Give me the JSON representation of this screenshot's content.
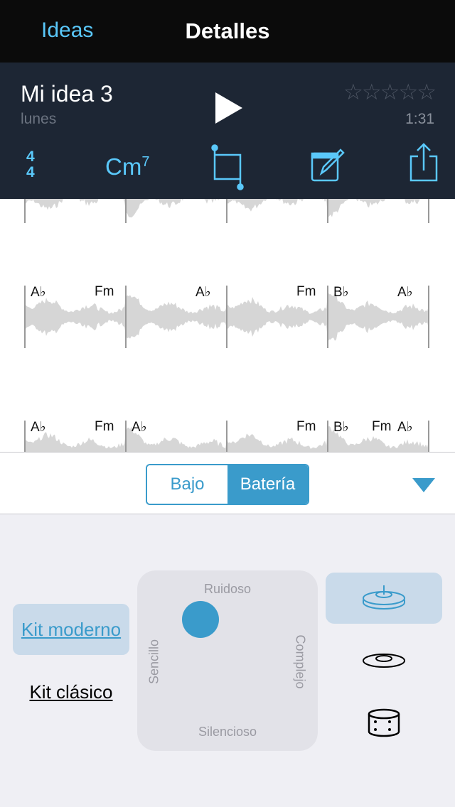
{
  "nav": {
    "back": "Ideas",
    "title": "Detalles"
  },
  "idea": {
    "name": "Mi idea 3",
    "date": "lunes",
    "rating": 0,
    "stars": "☆☆☆☆☆",
    "duration": "1:31"
  },
  "toolbar": {
    "time_sig_top": "4",
    "time_sig_bottom": "4",
    "chord": "Cm",
    "chord_ext": "7",
    "icons": [
      "trim-icon",
      "edit-icon",
      "share-icon"
    ]
  },
  "rows": [
    {
      "chords": []
    },
    {
      "chords": [
        {
          "bar": 0,
          "pos": "start",
          "label": "A♭"
        },
        {
          "bar": 0,
          "pos": "end",
          "label": "Fm"
        },
        {
          "bar": 1,
          "pos": "end",
          "label": "A♭"
        },
        {
          "bar": 2,
          "pos": "end",
          "label": "Fm"
        },
        {
          "bar": 3,
          "pos": "start",
          "label": "B♭"
        },
        {
          "bar": 3,
          "pos": "end",
          "label": "A♭"
        }
      ]
    },
    {
      "chords": [
        {
          "bar": 0,
          "pos": "start",
          "label": "A♭"
        },
        {
          "bar": 0,
          "pos": "end",
          "label": "Fm"
        },
        {
          "bar": 1,
          "pos": "start",
          "label": "A♭"
        },
        {
          "bar": 2,
          "pos": "end",
          "label": "Fm"
        },
        {
          "bar": 3,
          "pos": "start",
          "label": "B♭"
        },
        {
          "bar": 3,
          "pos": "mid",
          "label": "Fm"
        },
        {
          "bar": 3,
          "pos": "end",
          "label": "A♭"
        }
      ]
    }
  ],
  "segment": {
    "options": [
      "Bajo",
      "Batería"
    ],
    "selected": 1
  },
  "kits": [
    {
      "label": "Kit moderno",
      "selected": true
    },
    {
      "label": "Kit clásico",
      "selected": false
    }
  ],
  "pad": {
    "top": "Ruidoso",
    "bottom": "Silencioso",
    "left": "Sencillo",
    "right": "Complejo",
    "loudness": 0.73,
    "complexity": 0.35
  },
  "instruments": [
    {
      "icon": "hihat-icon",
      "selected": true
    },
    {
      "icon": "cymbal-icon",
      "selected": false
    },
    {
      "icon": "snare-drum-icon",
      "selected": false
    }
  ],
  "colors": {
    "accent": "#5ac8fa",
    "segment": "#3a9bcb",
    "selection": "#c9daea",
    "header": "#1d2634"
  }
}
